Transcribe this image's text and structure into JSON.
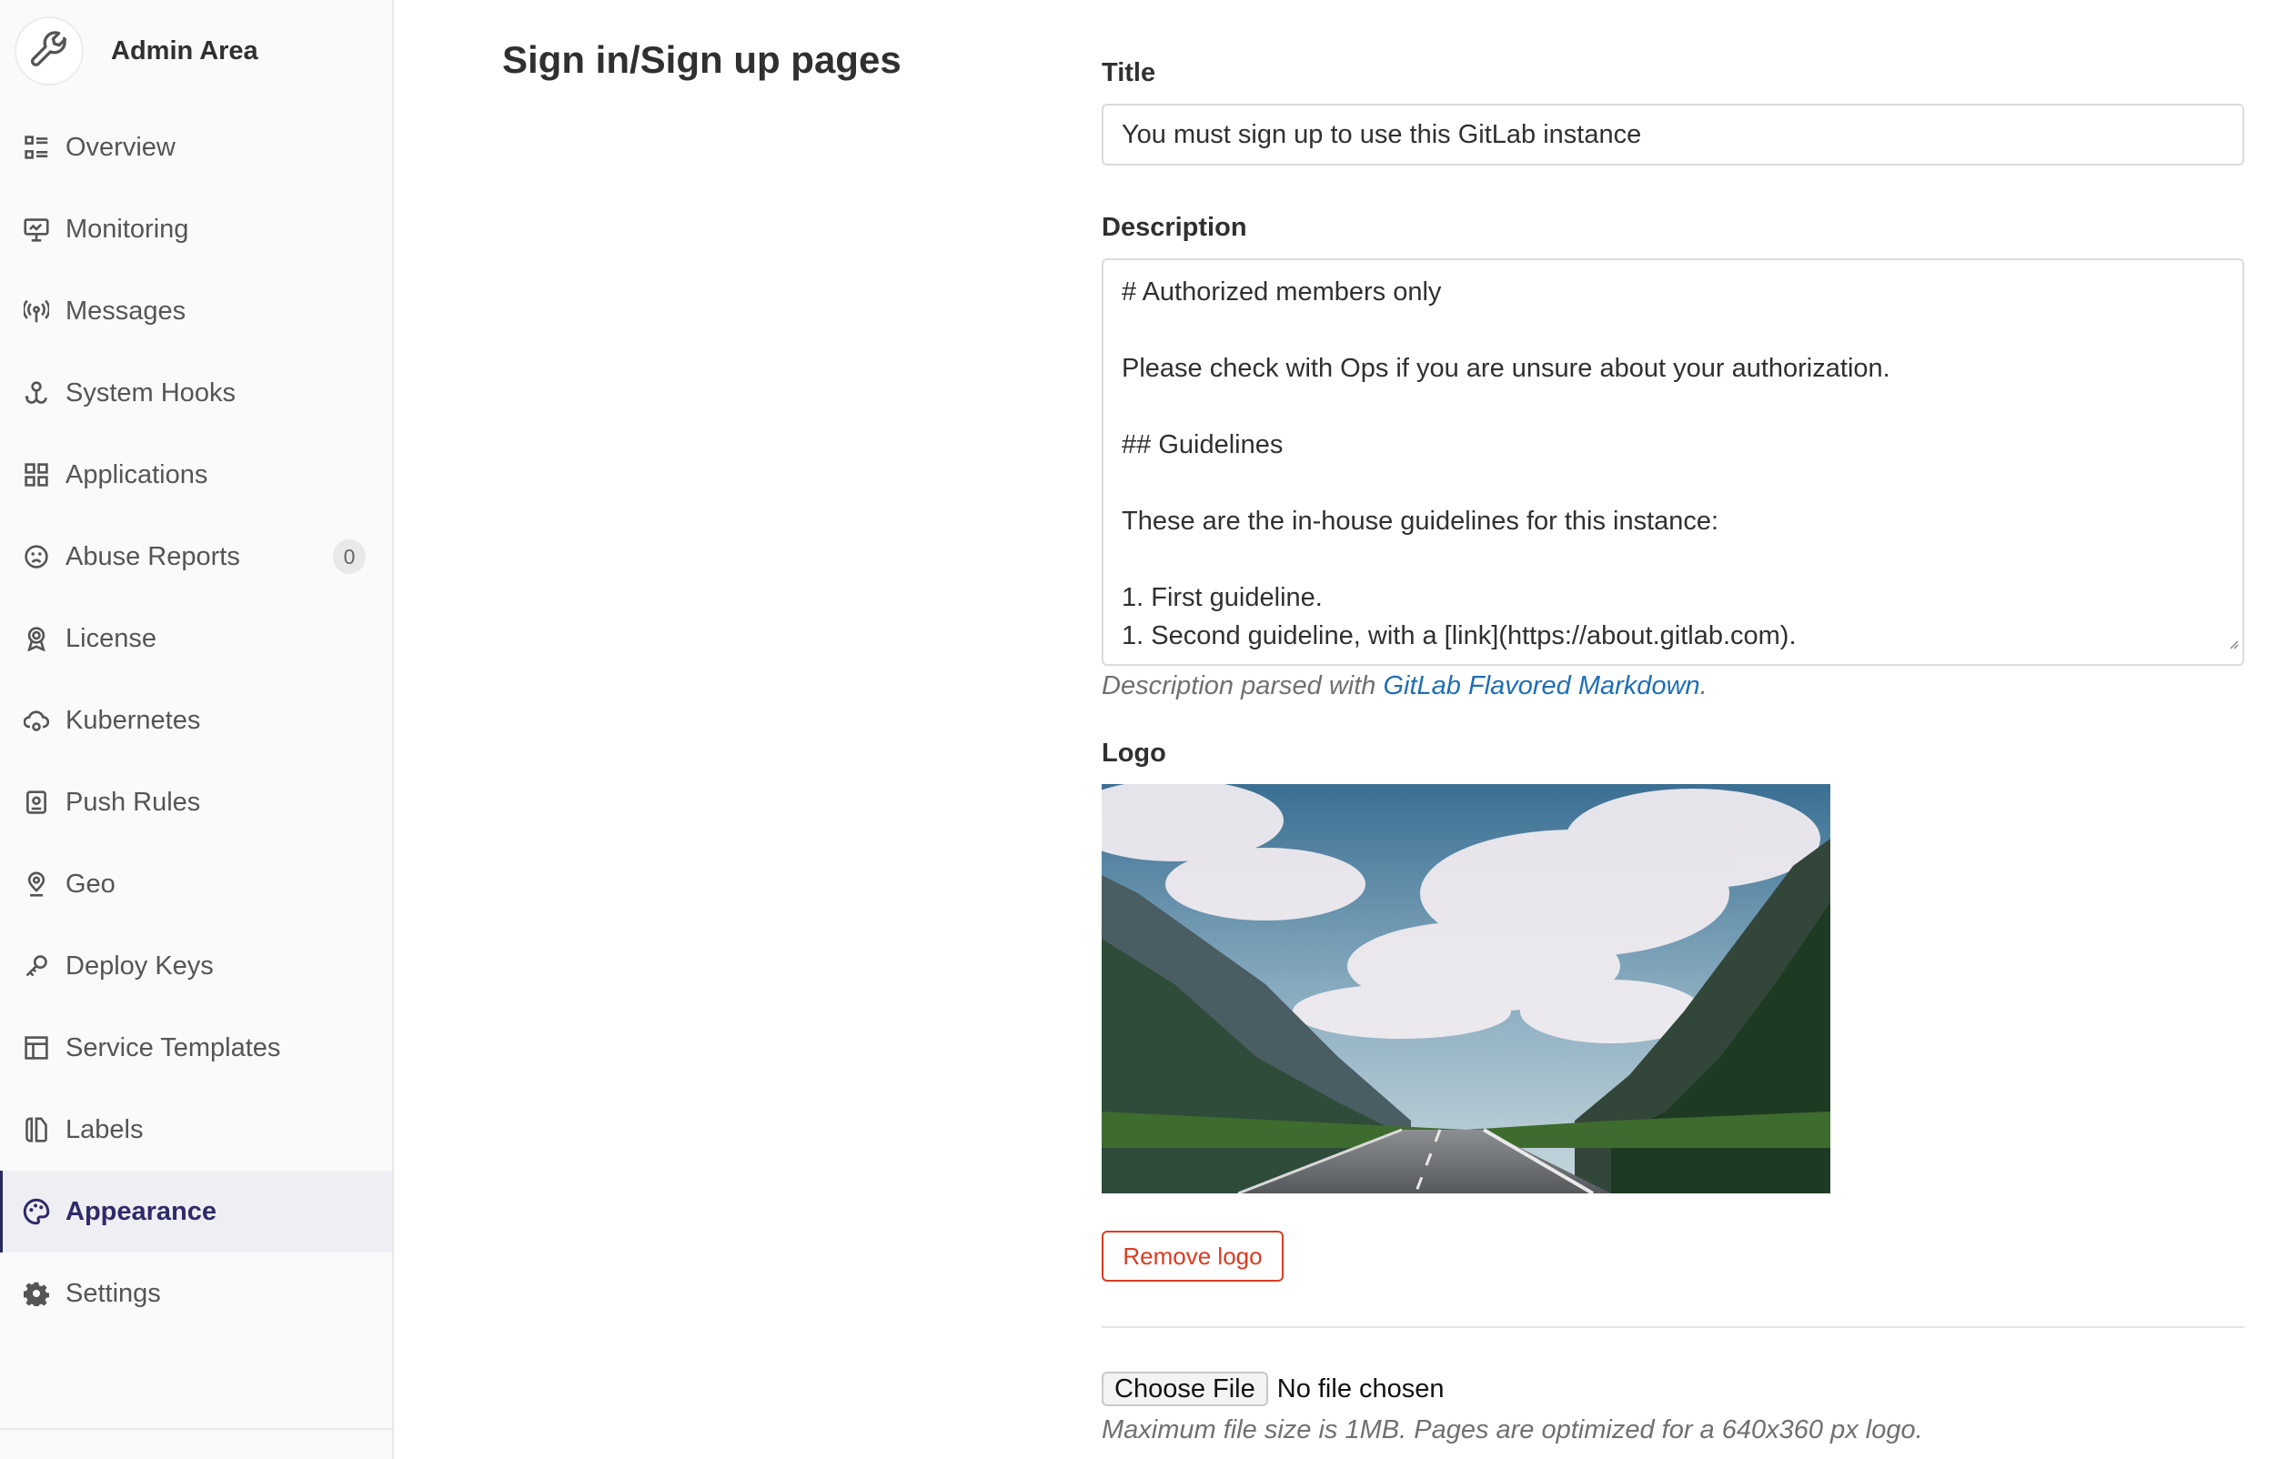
{
  "sidebar": {
    "title": "Admin Area",
    "items": [
      {
        "label": "Overview",
        "icon": "overview-icon"
      },
      {
        "label": "Monitoring",
        "icon": "monitor-icon"
      },
      {
        "label": "Messages",
        "icon": "broadcast-icon"
      },
      {
        "label": "System Hooks",
        "icon": "hook-icon"
      },
      {
        "label": "Applications",
        "icon": "applications-icon"
      },
      {
        "label": "Abuse Reports",
        "icon": "abuse-icon",
        "badge": "0"
      },
      {
        "label": "License",
        "icon": "license-icon"
      },
      {
        "label": "Kubernetes",
        "icon": "cloud-gear-icon"
      },
      {
        "label": "Push Rules",
        "icon": "push-rules-icon"
      },
      {
        "label": "Geo",
        "icon": "location-icon"
      },
      {
        "label": "Deploy Keys",
        "icon": "key-icon"
      },
      {
        "label": "Service Templates",
        "icon": "template-icon"
      },
      {
        "label": "Labels",
        "icon": "labels-icon"
      },
      {
        "label": "Appearance",
        "icon": "appearance-icon",
        "active": true
      },
      {
        "label": "Settings",
        "icon": "settings-icon"
      }
    ]
  },
  "main": {
    "section_title": "Sign in/Sign up pages",
    "title_label": "Title",
    "title_value": "You must sign up to use this GitLab instance",
    "description_label": "Description",
    "description_lines": [
      "# Authorized members only",
      "",
      "Please check with Ops if you are unsure about your authorization.",
      "",
      "## Guidelines",
      "",
      "These are the in-house guidelines for this instance:",
      "",
      "1. First guideline.",
      "1. Second guideline, with a [link](https://about.gitlab.com)."
    ],
    "description_help_prefix": "Description parsed with ",
    "description_help_link": "GitLab Flavored Markdown",
    "description_help_suffix": ".",
    "logo_label": "Logo",
    "remove_logo_label": "Remove logo",
    "choose_file_label": "Choose File",
    "file_status": "No file chosen",
    "file_help": "Maximum file size is 1MB. Pages are optimized for a 640x360 px logo."
  },
  "colors": {
    "sidebar_bg": "#fafafa",
    "active_item_bg": "#efeff3",
    "active_text": "#2f2a6b",
    "link": "#1f6fb6",
    "danger": "#db3b21"
  }
}
